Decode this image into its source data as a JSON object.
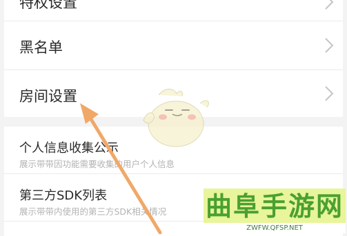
{
  "settings": {
    "items": [
      {
        "label": "特权设置"
      },
      {
        "label": "黑名单"
      },
      {
        "label": "房间设置"
      }
    ],
    "privacy_items": [
      {
        "label": "个人信息收集公示",
        "sub": "展示带带因功能需要收集的用户个人信息"
      },
      {
        "label": "第三方SDK列表",
        "sub": "展示带带内使用的第三方SDK相关情况"
      }
    ]
  },
  "watermark": {
    "title": "曲阜手游网",
    "url": "ZWFW.QFSP.NET"
  },
  "colors": {
    "arrow": "#f0a868",
    "watermark_bg": "#e8f59a",
    "watermark_text": "#4aa030"
  },
  "icons": {
    "chevron": "chevron-right-icon",
    "mascot": "duck-mascot-icon",
    "arrow": "pointer-arrow-icon"
  }
}
